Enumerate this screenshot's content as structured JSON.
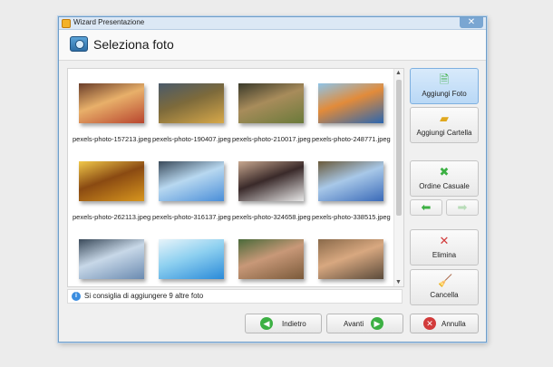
{
  "window": {
    "title": "Wizard Presentazione",
    "close_glyph": "✕"
  },
  "header": {
    "title": "Seleziona foto",
    "icon": "camera-icon"
  },
  "gallery": {
    "photos": [
      {
        "name": "pexels-photo-157213.jpeg",
        "colors": [
          "#b8452e",
          "#e8b06a",
          "#6a3d2a"
        ]
      },
      {
        "name": "pexels-photo-190407.jpeg",
        "colors": [
          "#d8a94a",
          "#7d6a3b",
          "#4a5a6a"
        ]
      },
      {
        "name": "pexels-photo-210017.jpeg",
        "colors": [
          "#6a7a3a",
          "#a88c5b",
          "#3a3a2a"
        ]
      },
      {
        "name": "pexels-photo-248771.jpeg",
        "colors": [
          "#2a66b0",
          "#e28b3a",
          "#8ec4e8"
        ]
      },
      {
        "name": "pexels-photo-262113.jpeg",
        "colors": [
          "#d8961e",
          "#8a4a12",
          "#f2c94a"
        ]
      },
      {
        "name": "pexels-photo-316137.jpeg",
        "colors": [
          "#4a8ed8",
          "#b8d8f0",
          "#3a4a5a"
        ]
      },
      {
        "name": "pexels-photo-324658.jpeg",
        "colors": [
          "#e8e8e8",
          "#3a2a2a",
          "#c8a890"
        ]
      },
      {
        "name": "pexels-photo-338515.jpeg",
        "colors": [
          "#3a6ab8",
          "#a8c8e8",
          "#6a5a3a"
        ]
      },
      {
        "name": "",
        "colors": [
          "#6a8ab0",
          "#c8d8e8",
          "#3a4a5a"
        ]
      },
      {
        "name": "",
        "colors": [
          "#2a8ad8",
          "#8ed0f0",
          "#e8f4fa"
        ]
      },
      {
        "name": "",
        "colors": [
          "#7a5a3a",
          "#c89878",
          "#4a6a3a"
        ]
      },
      {
        "name": "",
        "colors": [
          "#5a4a3a",
          "#d8a880",
          "#8a6a4a"
        ]
      }
    ]
  },
  "info": {
    "message": "Si consiglia di aggiungere 9 altre foto",
    "icon": "info-icon"
  },
  "side_buttons": {
    "add_photo": "Aggiungi Foto",
    "add_folder": "Aggiungi Cartella",
    "shuffle": "Ordine Casuale",
    "delete": "Elimina",
    "clear": "Cancella"
  },
  "footer": {
    "back": "Indietro",
    "next": "Avanti",
    "cancel": "Annulla"
  },
  "colors": {
    "accent": "#7eb0e0",
    "green": "#3cb043",
    "red": "#d23b3b"
  }
}
